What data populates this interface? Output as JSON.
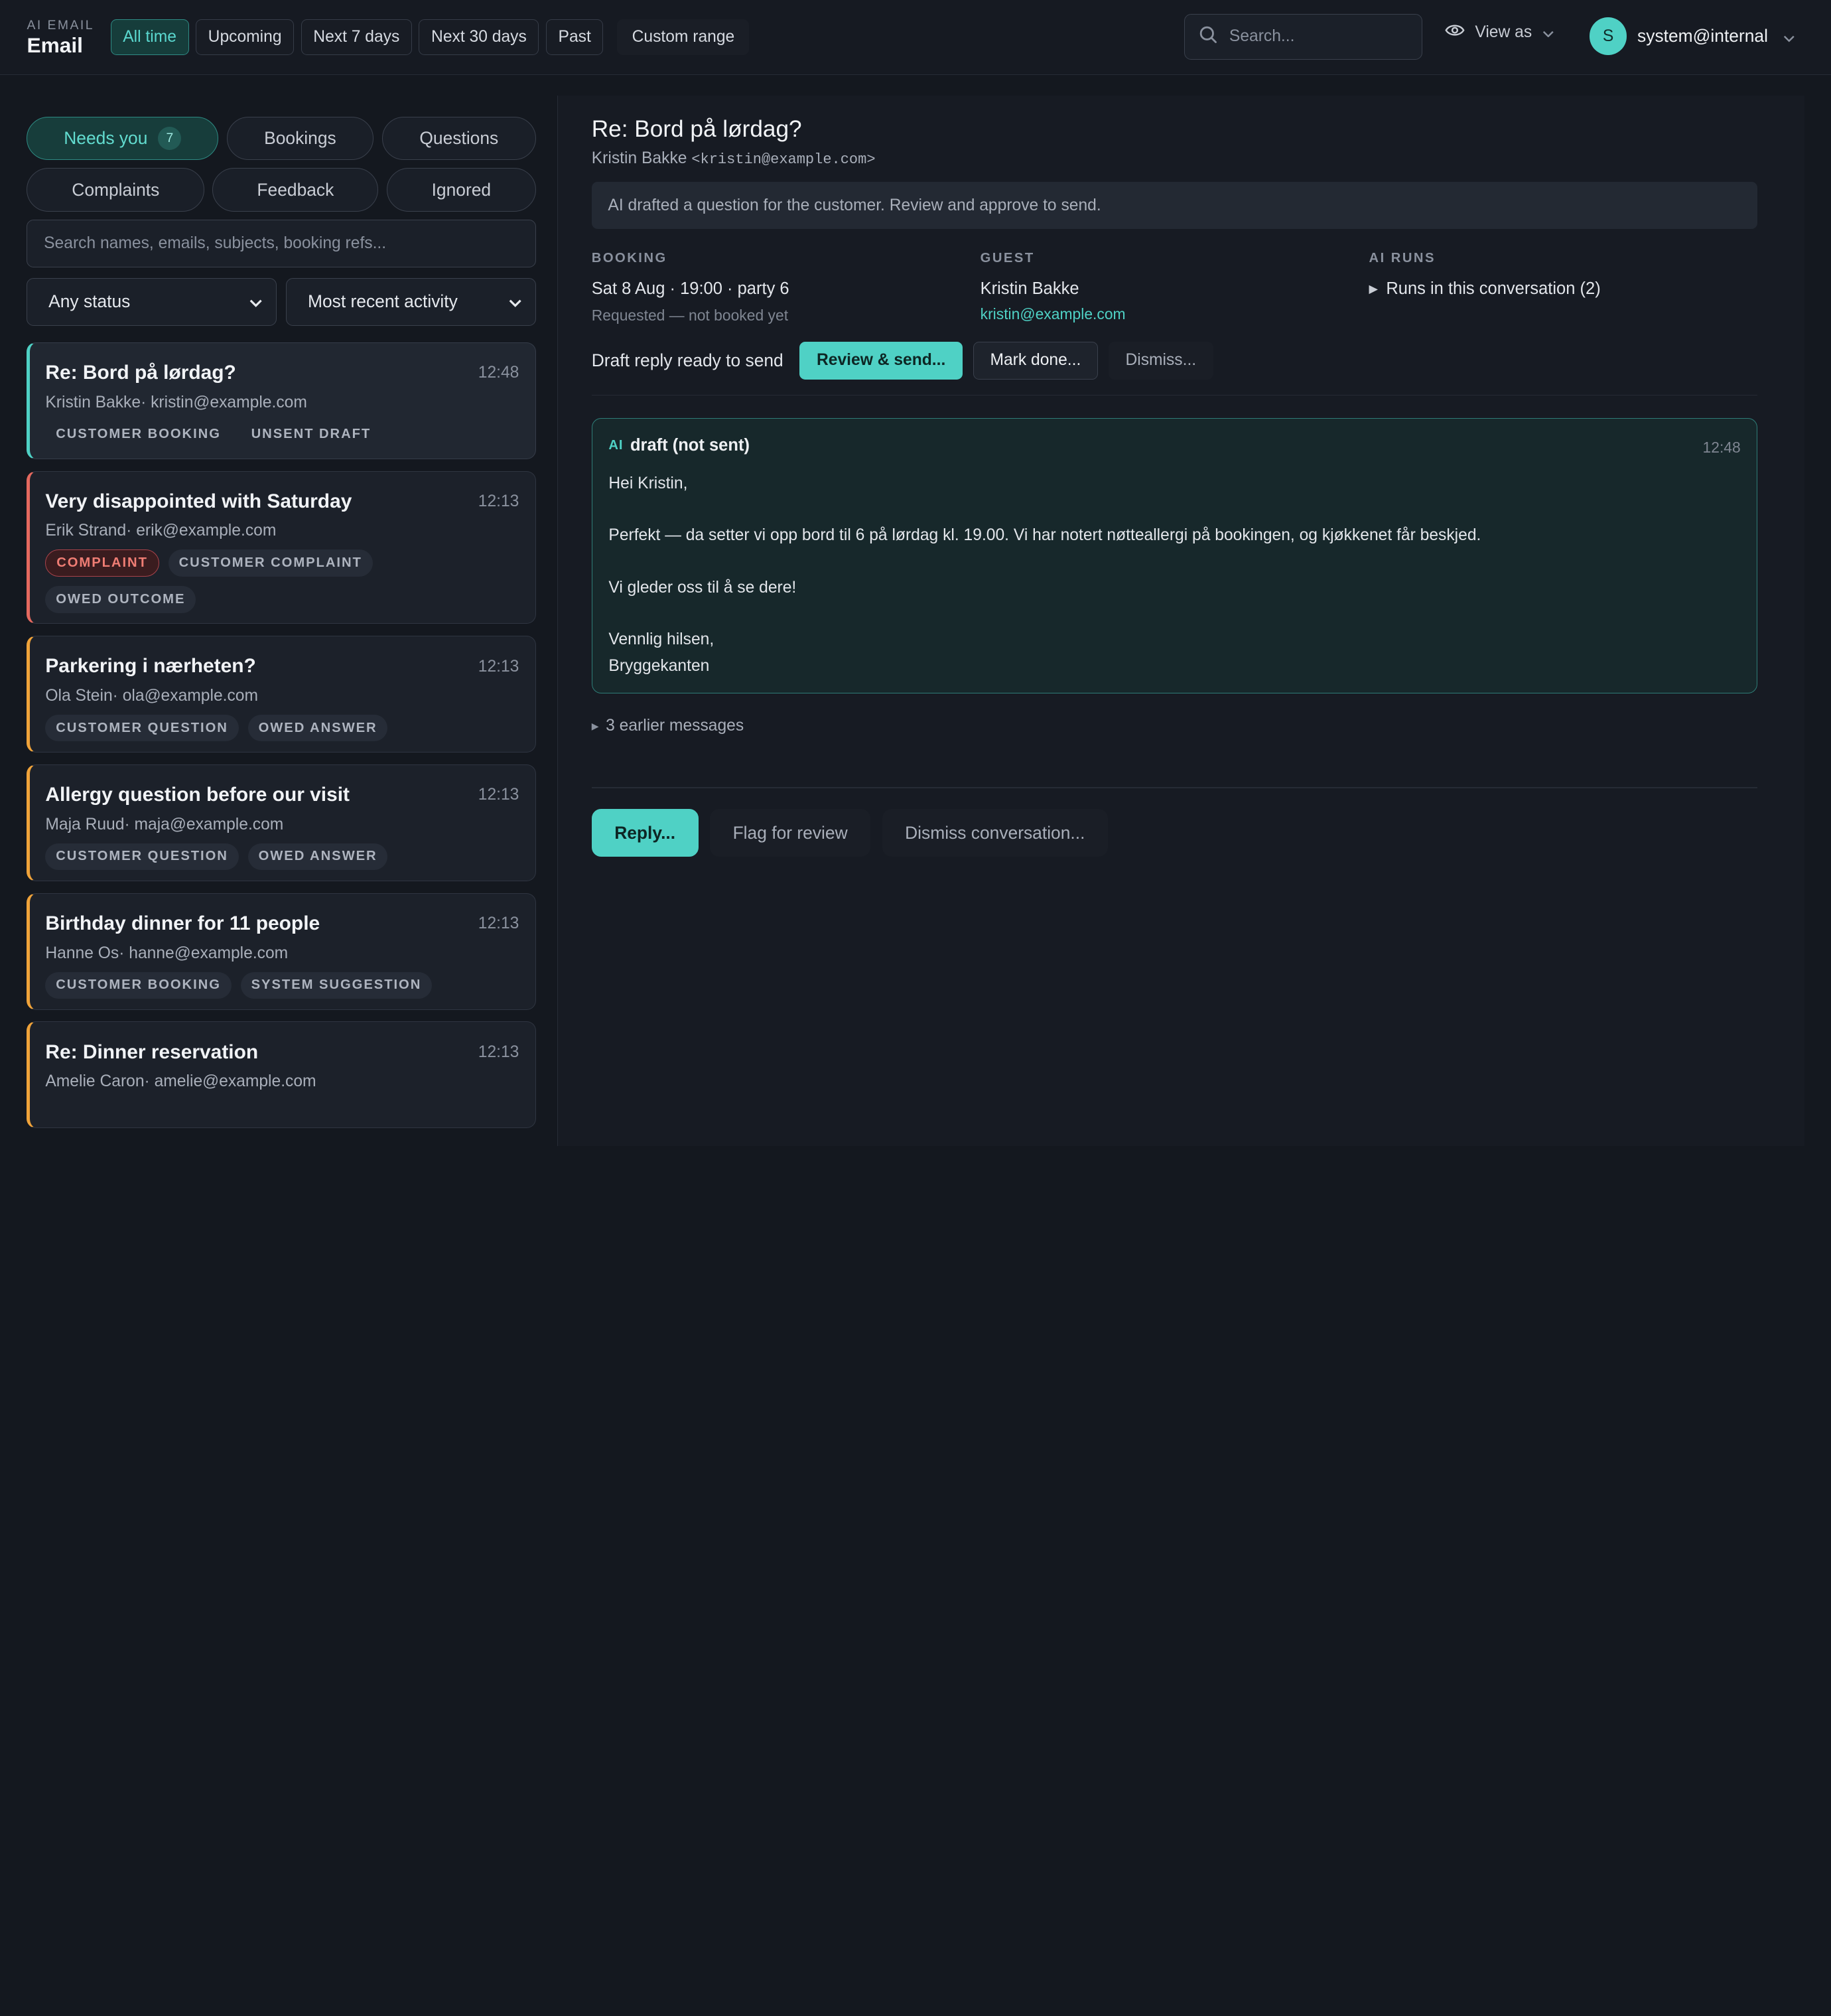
{
  "header": {
    "kicker": "AI EMAIL",
    "title": "Email",
    "ranges": [
      "All time",
      "Upcoming",
      "Next 7 days",
      "Next 30 days",
      "Past"
    ],
    "custom_range": "Custom range",
    "search_placeholder": "Search...",
    "view_as": "View as",
    "user_initial": "S",
    "user_name": "system@internal"
  },
  "filters": {
    "chips": [
      "Needs you",
      "Bookings",
      "Questions",
      "Complaints",
      "Feedback",
      "Ignored"
    ],
    "needs_you_count": "7",
    "search_placeholder": "Search names, emails, subjects, booking refs...",
    "status_select": "Any status",
    "sort_select": "Most recent activity"
  },
  "conversations": [
    {
      "subject": "Re: Bord på lørdag?",
      "time": "12:48",
      "name": "Kristin Bakke",
      "email": "kristin@example.com",
      "tags": [
        "CUSTOMER BOOKING",
        "UNSENT DRAFT"
      ]
    },
    {
      "subject": "Very disappointed with Saturday",
      "time": "12:13",
      "name": "Erik Strand",
      "email": "erik@example.com",
      "tags": [
        "COMPLAINT",
        "CUSTOMER COMPLAINT",
        "OWED OUTCOME"
      ]
    },
    {
      "subject": "Parkering i nærheten?",
      "time": "12:13",
      "name": "Ola Stein",
      "email": "ola@example.com",
      "tags": [
        "CUSTOMER QUESTION",
        "OWED ANSWER"
      ]
    },
    {
      "subject": "Allergy question before our visit",
      "time": "12:13",
      "name": "Maja Ruud",
      "email": "maja@example.com",
      "tags": [
        "CUSTOMER QUESTION",
        "OWED ANSWER"
      ]
    },
    {
      "subject": "Birthday dinner for 11 people",
      "time": "12:13",
      "name": "Hanne Os",
      "email": "hanne@example.com",
      "tags": [
        "CUSTOMER BOOKING",
        "SYSTEM SUGGESTION"
      ]
    },
    {
      "subject": "Re: Dinner reservation",
      "time": "12:13",
      "name": "Amelie Caron",
      "email": "amelie@example.com",
      "tags": []
    }
  ],
  "detail": {
    "subject": "Re: Bord på lørdag?",
    "sender_name": "Kristin Bakke",
    "sender_email": "<kristin@example.com>",
    "ai_note": "AI drafted a question for the customer. Review and approve to send.",
    "booking_label": "BOOKING",
    "booking_main": "Sat 8 Aug · 19:00 · party 6",
    "booking_sub": "Requested — not booked yet",
    "guest_label": "GUEST",
    "guest_name": "Kristin Bakke",
    "guest_email": "kristin@example.com",
    "runs_label": "AI RUNS",
    "runs_text": "Runs in this conversation (2)",
    "draft_ready": "Draft reply ready to send",
    "review_send": "Review & send...",
    "mark_done": "Mark done...",
    "dismiss": "Dismiss...",
    "draft_badge": "AI",
    "draft_title": "draft (not sent)",
    "draft_time": "12:48",
    "draft_lines": [
      "Hei Kristin,",
      "",
      "Perfekt — da setter vi opp bord til 6 på lørdag kl. 19.00. Vi har notert nøtteallergi på bookingen, og kjøkkenet får beskjed.",
      "",
      "Vi gleder oss til å se dere!",
      "",
      "Vennlig hilsen,",
      "Bryggekanten"
    ],
    "earlier": "3 earlier messages",
    "reply": "Reply...",
    "flag": "Flag for review",
    "dismiss_conv": "Dismiss conversation..."
  },
  "colors": {
    "accent": "#4fd1c5",
    "complaint": "#e5695f",
    "pending": "#f0a33a",
    "background": "#14181f"
  }
}
